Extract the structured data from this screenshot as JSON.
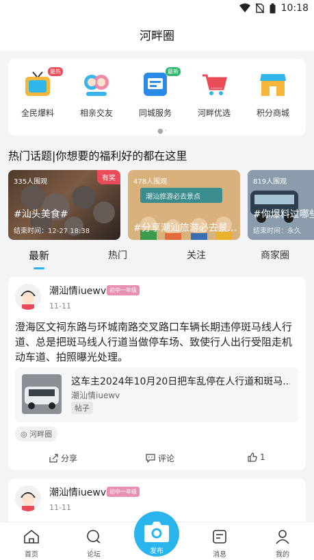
{
  "status": {
    "time": "10:18"
  },
  "header": {
    "title": "河畔圈"
  },
  "quick_links": [
    {
      "label": "全民爆料",
      "icon": "tv-icon",
      "badge": "最热"
    },
    {
      "label": "相亲交友",
      "icon": "couple-icon",
      "badge": ""
    },
    {
      "label": "同城服务",
      "icon": "city-service-icon",
      "badge": "最新"
    },
    {
      "label": "河畔优选",
      "icon": "shopping-cart-icon",
      "badge": ""
    },
    {
      "label": "积分商城",
      "icon": "store-icon",
      "badge": ""
    }
  ],
  "section": {
    "title": "热门话题|你想要的福利好的都在这里"
  },
  "topics": [
    {
      "views": "335人围观",
      "name": "#汕头美食#",
      "end": "结束时间：12-27 18:38",
      "tag": "有奖"
    },
    {
      "views": "478人围观",
      "name": "#分享潮汕旅游必去景...",
      "image_text": "潮汕旅游必去景点",
      "end": "",
      "tag": ""
    },
    {
      "views": "819人围观",
      "name": "#你爆料过哪些",
      "end": "结束时间：永久",
      "tag": ""
    }
  ],
  "tabs": [
    "最新",
    "热门",
    "关注",
    "商家圈"
  ],
  "posts": [
    {
      "user": "潮汕情iuewv",
      "level": "初中一年级",
      "date": "11-11",
      "text": "澄海区文祠东路与环城南路交叉路口车辆长期违停斑马线人行道、总是把斑马线人行道当做停车场、致使行人出行受阻走机动车道、拍照曝光处理。",
      "ref_title": "这车主2024年10月20日把车乱停在人行道和斑马...",
      "ref_author": "潮汕情iuewv",
      "ref_tag": "帖子",
      "circle": "河畔圈",
      "share": "分享",
      "comment": "评论",
      "likes": "1"
    },
    {
      "user": "潮汕情iuewv",
      "level": "初中一年级",
      "date": "11-11"
    }
  ],
  "nav": {
    "home": "首页",
    "forum": "论坛",
    "publish": "发布",
    "messages": "消息",
    "me": "我的"
  },
  "colors": {
    "accent": "#2ab2ef",
    "hot_badge": "#e94b58",
    "level_badge": "#e88fb4"
  }
}
